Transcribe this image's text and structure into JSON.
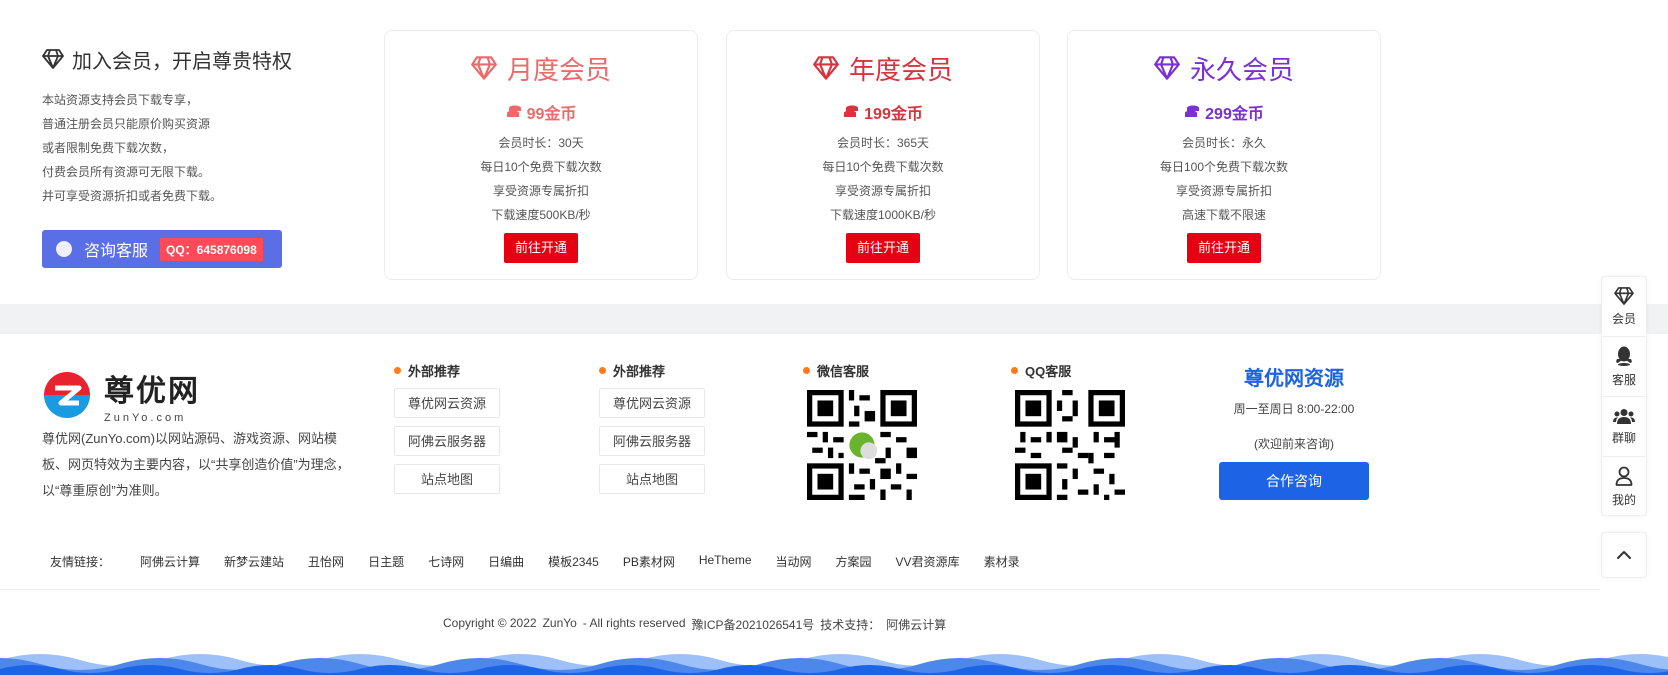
{
  "colors": {
    "monthly": "#ee6a6a",
    "yearly": "#d9343e",
    "lifetime": "#7b2fd6",
    "blue": "#1d63e6",
    "red_button": "#e50012",
    "consult": "#5a6fe6"
  },
  "intro": {
    "title": "加入会员，开启尊贵特权",
    "lines": [
      "本站资源支持会员下载专享，",
      "普通注册会员只能原价购买资源",
      "或者限制免费下载次数，",
      "付费会员所有资源可无限下载。",
      "并可享受资源折扣或者免费下载。"
    ],
    "consult_label": "咨询客服",
    "qq_badge": "QQ：645876098"
  },
  "plans": [
    {
      "name": "月度会员",
      "price": "99金币",
      "features": [
        "会员时长：30天",
        "每日10个免费下载次数",
        "享受资源专属折扣",
        "下载速度500KB/秒"
      ],
      "button": "前往开通"
    },
    {
      "name": "年度会员",
      "price": "199金币",
      "features": [
        "会员时长：365天",
        "每日10个免费下载次数",
        "享受资源专属折扣",
        "下载速度1000KB/秒"
      ],
      "button": "前往开通"
    },
    {
      "name": "永久会员",
      "price": "299金币",
      "features": [
        "会员时长：永久",
        "每日100个免费下载次数",
        "享受资源专属折扣",
        "高速下载不限速"
      ],
      "button": "前往开通"
    }
  ],
  "footer": {
    "logo_cn": "尊优网",
    "logo_en": "ZunYo.com",
    "about": "尊优网(ZunYo.com)以网站源码、游戏资源、网站模板、网页特效为主要内容，以“共享创造价值”为理念，以“尊重原创”为准则。",
    "col1": {
      "title": "外部推荐",
      "links": [
        "尊优网云资源",
        "阿佛云服务器",
        "站点地图"
      ]
    },
    "col2": {
      "title": "外部推荐",
      "links": [
        "尊优网云资源",
        "阿佛云服务器",
        "站点地图"
      ]
    },
    "wechat_title": "微信客服",
    "qq_title": "QQ客服",
    "brand": {
      "name": "尊优网资源",
      "hours": "周一至周日 8:00-22:00",
      "welcome": "(欢迎前来咨询)",
      "button": "合作咨询"
    },
    "friend_label": "友情链接：",
    "friend_links": [
      "阿佛云计算",
      "新梦云建站",
      "丑怡网",
      "日主题",
      "七诗网",
      "日编曲",
      "模板2345",
      "PB素材网",
      "HeTheme",
      "当动网",
      "方案园",
      "VV君资源库",
      "素材录"
    ],
    "copyright": [
      "Copyright © 2022",
      "ZunYo",
      "- All rights reserved",
      "豫ICP备2021026541号",
      "技术支持：",
      "阿佛云计算"
    ]
  },
  "side_bar": [
    {
      "label": "会员",
      "icon": "diamond-icon"
    },
    {
      "label": "客服",
      "icon": "qq-penguin-icon"
    },
    {
      "label": "群聊",
      "icon": "group-icon"
    },
    {
      "label": "我的",
      "icon": "user-icon"
    }
  ]
}
